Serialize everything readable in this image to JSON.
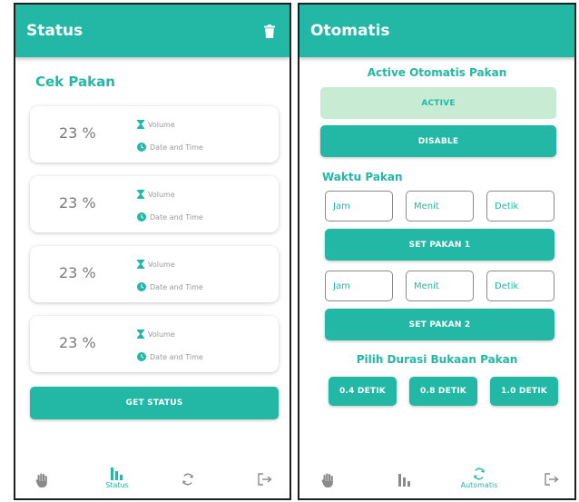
{
  "status_screen": {
    "title": "Status",
    "section_title": "Cek Pakan",
    "cards": [
      {
        "value": "23 %",
        "volume_label": "Volume",
        "datetime_label": "Date and Time"
      },
      {
        "value": "23 %",
        "volume_label": "Volume",
        "datetime_label": "Date and Time"
      },
      {
        "value": "23 %",
        "volume_label": "Volume",
        "datetime_label": "Date and Time"
      },
      {
        "value": "23 %",
        "volume_label": "Volume",
        "datetime_label": "Date and Time"
      }
    ],
    "get_status_label": "GET STATUS",
    "nav": {
      "status_label": "Status"
    }
  },
  "otomatis_screen": {
    "title": "Otomatis",
    "active_title": "Active Otomatis Pakan",
    "active_label": "ACTIVE",
    "disable_label": "DISABLE",
    "waktu_title": "Waktu Pakan",
    "schedule1": {
      "jam_placeholder": "Jam",
      "menit_placeholder": "Menit",
      "detik_placeholder": "Detik",
      "set_label": "SET PAKAN 1"
    },
    "schedule2": {
      "jam_placeholder": "Jam",
      "menit_placeholder": "Menit",
      "detik_placeholder": "Detik",
      "set_label": "SET PAKAN 2"
    },
    "durasi_title": "Pilih Durasi Bukaan Pakan",
    "durations": [
      "0.4 DETIK",
      "0.8 DETIK",
      "1.0 DETIK"
    ],
    "nav": {
      "automatis_label": "Automatis"
    }
  },
  "colors": {
    "accent": "#22b8a5",
    "active_bg": "#c8ebd4",
    "icon_gray": "#8a8a8a"
  },
  "icons": {
    "trash": "trash-icon",
    "hand": "hand-icon",
    "bars": "bar-chart-icon",
    "sync": "sync-icon",
    "logout": "logout-icon",
    "hourglass": "hourglass-icon",
    "clock": "clock-icon"
  }
}
